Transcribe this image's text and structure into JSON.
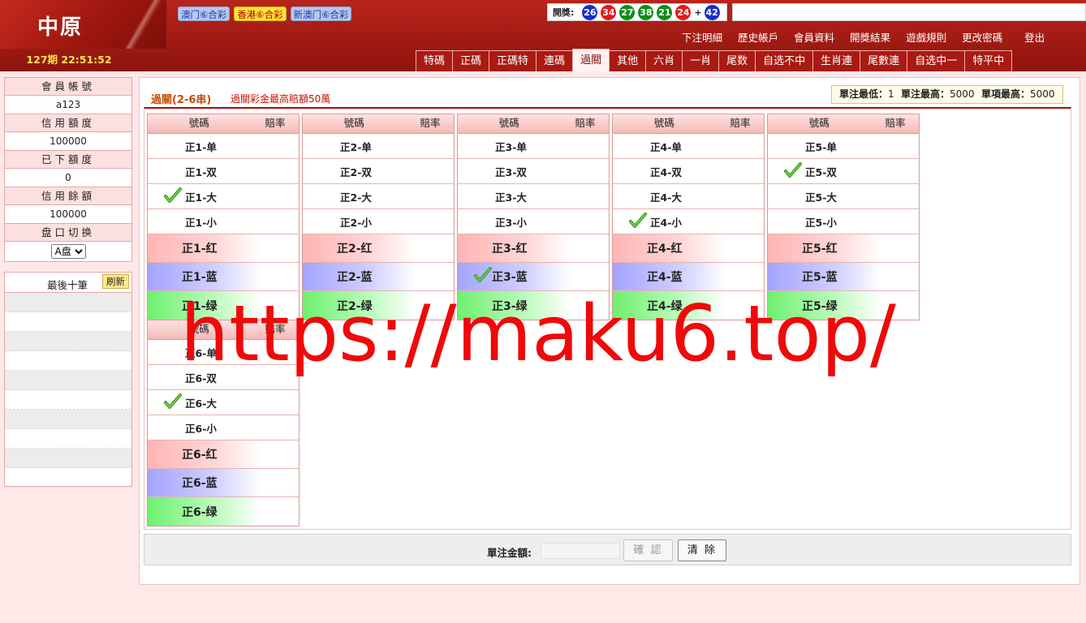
{
  "header": {
    "logo": "中原",
    "period": "127期 22:51:52",
    "lottery_tabs": [
      {
        "label": "澳门⑥合彩",
        "active": false
      },
      {
        "label": "香港⑥合彩",
        "active": true
      },
      {
        "label": "新澳门⑥合彩",
        "active": false
      }
    ],
    "draw": {
      "label": "開獎:",
      "balls": [
        {
          "n": "26",
          "color": "#1b2fc8"
        },
        {
          "n": "34",
          "color": "#e21a1a"
        },
        {
          "n": "27",
          "color": "#0d8f1a"
        },
        {
          "n": "38",
          "color": "#0d8f1a"
        },
        {
          "n": "21",
          "color": "#0d8f1a"
        },
        {
          "n": "24",
          "color": "#e21a1a"
        }
      ],
      "plus": "+",
      "special": {
        "n": "42",
        "color": "#1b2fc8"
      }
    },
    "top_links": [
      "下注明細",
      "歷史帳戶",
      "會員資料",
      "開獎結果",
      "遊戲規則",
      "更改密碼"
    ],
    "logout": "登出",
    "nav_tabs": [
      {
        "label": "特碼",
        "active": false
      },
      {
        "label": "正碼",
        "active": false
      },
      {
        "label": "正碼特",
        "active": false
      },
      {
        "label": "連碼",
        "active": false
      },
      {
        "label": "過關",
        "active": true
      },
      {
        "label": "其他",
        "active": false
      },
      {
        "label": "六肖",
        "active": false
      },
      {
        "label": "一肖",
        "active": false
      },
      {
        "label": "尾数",
        "active": false
      },
      {
        "label": "自选不中",
        "active": false
      },
      {
        "label": "生肖連",
        "active": false
      },
      {
        "label": "尾數連",
        "active": false
      },
      {
        "label": "自选中一",
        "active": false
      },
      {
        "label": "特平中",
        "active": false
      }
    ]
  },
  "account": {
    "account_label": "會員帳號",
    "account_value": "a123",
    "credit_label": "信用額度",
    "credit_value": "100000",
    "placed_label": "已下額度",
    "placed_value": "0",
    "balance_label": "信用餘額",
    "balance_value": "100000",
    "switch_label": "盘口切换",
    "switch_value": "A盘"
  },
  "last_ten": {
    "title": "最後十筆",
    "refresh": "刷新"
  },
  "main": {
    "title": "過關(2-6串)",
    "note": "過關彩金最高賠額50萬",
    "limits": {
      "min_label": "單注最低：",
      "min_value": "1",
      "max_label": "單注最高：",
      "max_value": "5000",
      "item_max_label": "單項最高：",
      "item_max_value": "5000"
    },
    "header_num": "號碼",
    "header_odds": "賠率",
    "groups": [
      {
        "options": [
          "正1-单",
          "正1-双",
          "正1-大",
          "正1-小"
        ],
        "colors": [
          "正1-红",
          "正1-蓝",
          "正1-绿"
        ],
        "checked": [
          2
        ]
      },
      {
        "options": [
          "正2-单",
          "正2-双",
          "正2-大",
          "正2-小"
        ],
        "colors": [
          "正2-红",
          "正2-蓝",
          "正2-绿"
        ],
        "checked": []
      },
      {
        "options": [
          "正3-单",
          "正3-双",
          "正3-大",
          "正3-小"
        ],
        "colors": [
          "正3-红",
          "正3-蓝",
          "正3-绿"
        ],
        "checked": [
          5
        ]
      },
      {
        "options": [
          "正4-单",
          "正4-双",
          "正4-大",
          "正4-小"
        ],
        "colors": [
          "正4-红",
          "正4-蓝",
          "正4-绿"
        ],
        "checked": [
          3
        ]
      },
      {
        "options": [
          "正5-单",
          "正5-双",
          "正5-大",
          "正5-小"
        ],
        "colors": [
          "正5-红",
          "正5-蓝",
          "正5-绿"
        ],
        "checked": [
          1
        ]
      },
      {
        "options": [
          "正6-单",
          "正6-双",
          "正6-大",
          "正6-小"
        ],
        "colors": [
          "正6-红",
          "正6-蓝",
          "正6-绿"
        ],
        "checked": [
          2
        ]
      }
    ],
    "amount_label": "單注金額:",
    "confirm": "確 認",
    "clear": "清 除"
  },
  "watermark": "https://maku6.top/"
}
